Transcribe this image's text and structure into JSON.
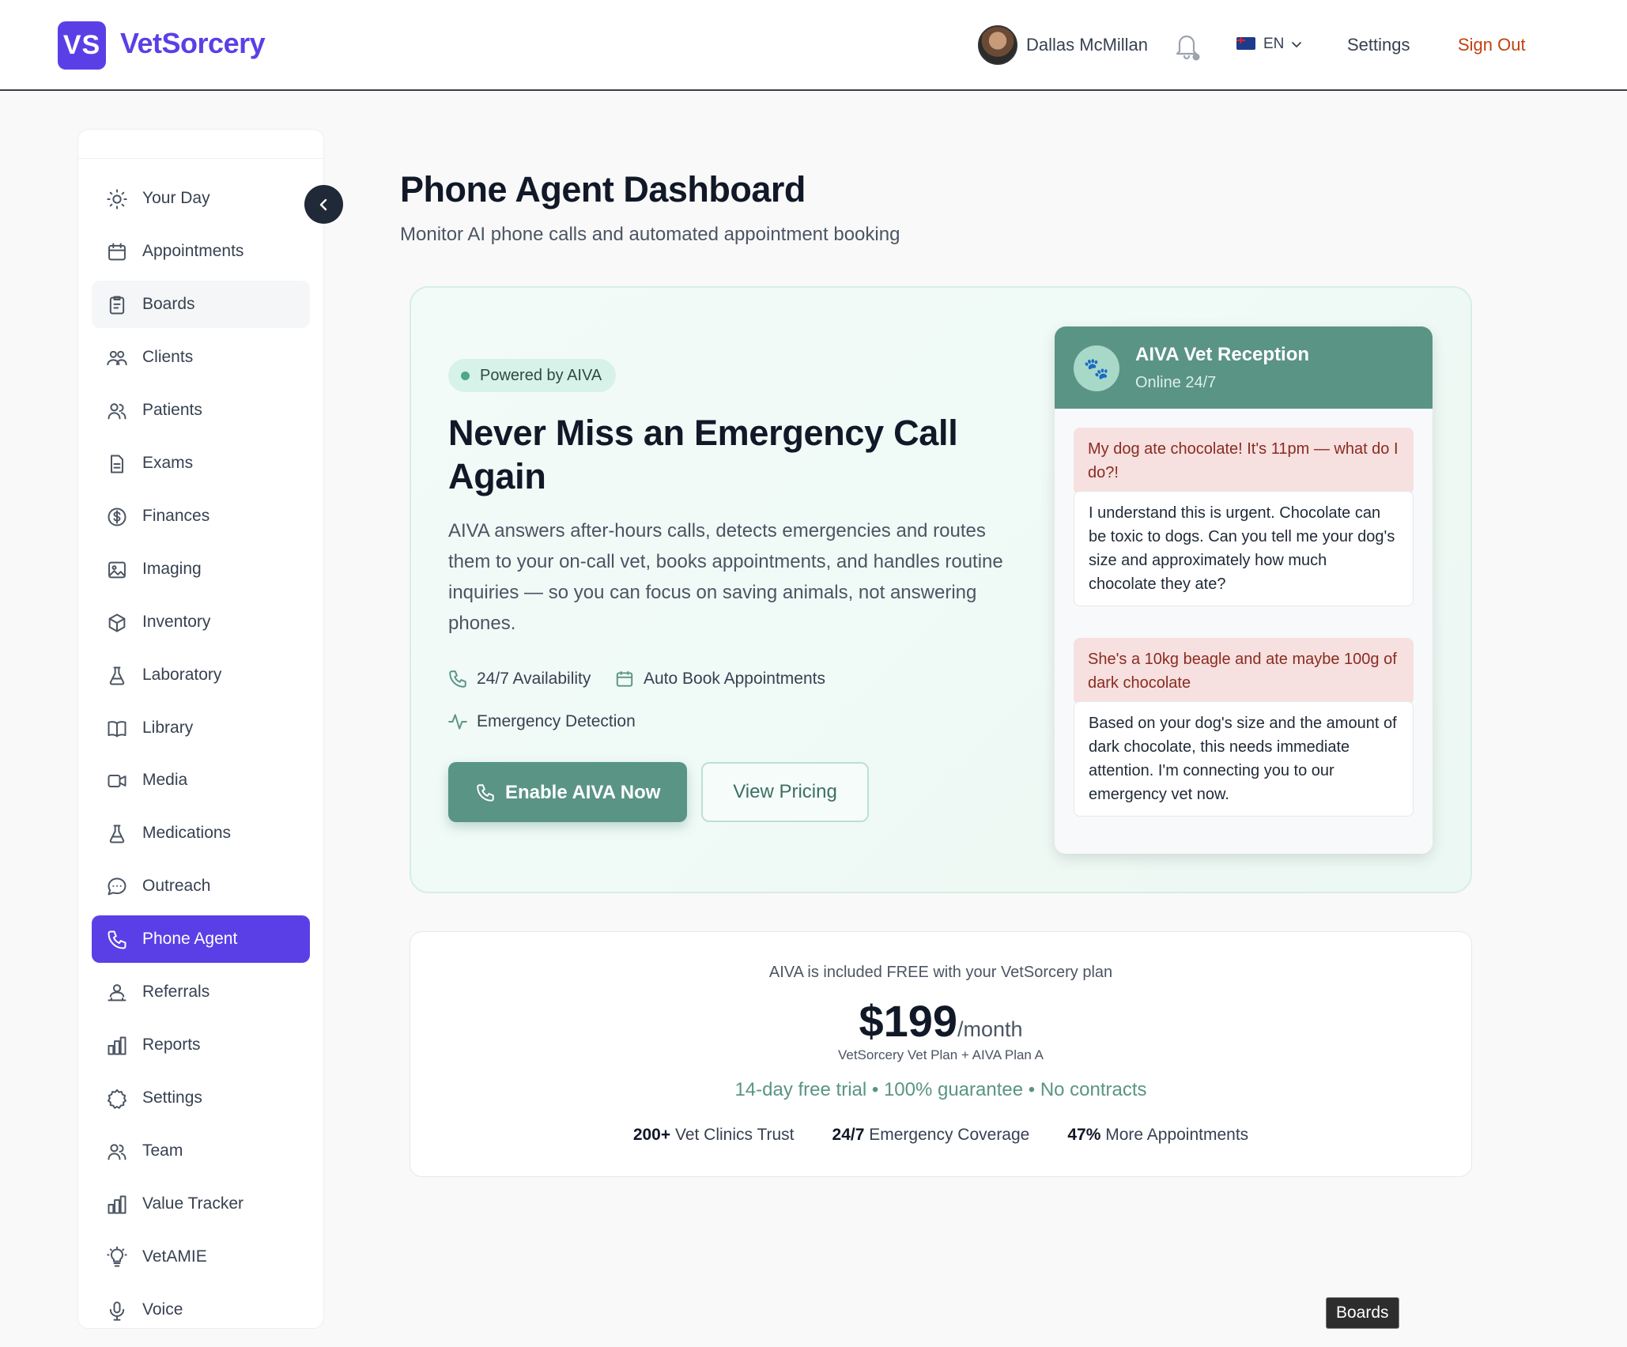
{
  "header": {
    "logo_text": "VS",
    "brand": "VetSorcery",
    "user_name": "Dallas McMillan",
    "lang": "EN",
    "settings_label": "Settings",
    "signout_label": "Sign Out",
    "signout_color": "#c2410c",
    "brand_color": "#5b3fe6"
  },
  "sidebar": {
    "items": [
      {
        "label": "Your Day",
        "icon": "sun-icon"
      },
      {
        "label": "Appointments",
        "icon": "calendar-icon"
      },
      {
        "label": "Boards",
        "icon": "clipboard-icon"
      },
      {
        "label": "Clients",
        "icon": "users-icon"
      },
      {
        "label": "Patients",
        "icon": "user-group-icon"
      },
      {
        "label": "Exams",
        "icon": "document-icon"
      },
      {
        "label": "Finances",
        "icon": "dollar-circle-icon"
      },
      {
        "label": "Imaging",
        "icon": "image-icon"
      },
      {
        "label": "Inventory",
        "icon": "box-icon"
      },
      {
        "label": "Laboratory",
        "icon": "flask-icon"
      },
      {
        "label": "Library",
        "icon": "book-icon"
      },
      {
        "label": "Media",
        "icon": "video-icon"
      },
      {
        "label": "Medications",
        "icon": "flask-icon"
      },
      {
        "label": "Outreach",
        "icon": "chat-bubble-icon"
      },
      {
        "label": "Phone Agent",
        "icon": "phone-icon"
      },
      {
        "label": "Referrals",
        "icon": "referral-icon"
      },
      {
        "label": "Reports",
        "icon": "bar-chart-icon"
      },
      {
        "label": "Settings",
        "icon": "cog-icon"
      },
      {
        "label": "Team",
        "icon": "user-group-icon"
      },
      {
        "label": "Value Tracker",
        "icon": "bar-chart-icon"
      },
      {
        "label": "VetAMIE",
        "icon": "lightbulb-icon"
      },
      {
        "label": "Voice",
        "icon": "microphone-icon"
      }
    ],
    "active_item": "Phone Agent",
    "hover_item": "Boards",
    "active_color": "#5b3fe6"
  },
  "page": {
    "title": "Phone Agent Dashboard",
    "subtitle": "Monitor AI phone calls and automated appointment booking"
  },
  "hero": {
    "badge": "Powered by AIVA",
    "title": "Never Miss an Emergency Call Again",
    "description": "AIVA answers after-hours calls, detects emergencies and routes them to your on-call vet, books appointments, and handles routine inquiries — so you can focus on saving animals, not answering phones.",
    "features": [
      "24/7 Availability",
      "Auto Book Appointments",
      "Emergency Detection"
    ],
    "primary_button": "Enable AIVA Now",
    "secondary_button": "View Pricing",
    "accent_color": "#5a9485"
  },
  "chat": {
    "title": "AIVA Vet Reception",
    "status": "Online 24/7",
    "avatar_glyph": "🐾",
    "messages": [
      {
        "role": "user",
        "text": "My dog ate chocolate! It's 11pm — what do I do?!"
      },
      {
        "role": "bot",
        "text": "I understand this is urgent. Chocolate can be toxic to dogs. Can you tell me your dog's size and approximately how much chocolate they ate?"
      },
      {
        "role": "user",
        "text": "She's a 10kg beagle and ate maybe 100g of dark chocolate"
      },
      {
        "role": "bot",
        "text": "Based on your dog's size and the amount of dark chocolate, this needs immediate attention. I'm connecting you to our emergency vet now."
      }
    ]
  },
  "pricing": {
    "included": "AIVA is included FREE with your VetSorcery plan",
    "price": "$199",
    "per": "/month",
    "plan": "VetSorcery Vet Plan + AIVA Plan A",
    "trial": "14-day free trial • 100% guarantee • No contracts",
    "stats": [
      {
        "value": "200+",
        "label": "Vet Clinics Trust"
      },
      {
        "value": "24/7",
        "label": "Emergency Coverage"
      },
      {
        "value": "47%",
        "label": "More Appointments"
      }
    ]
  },
  "tooltip": "Boards"
}
